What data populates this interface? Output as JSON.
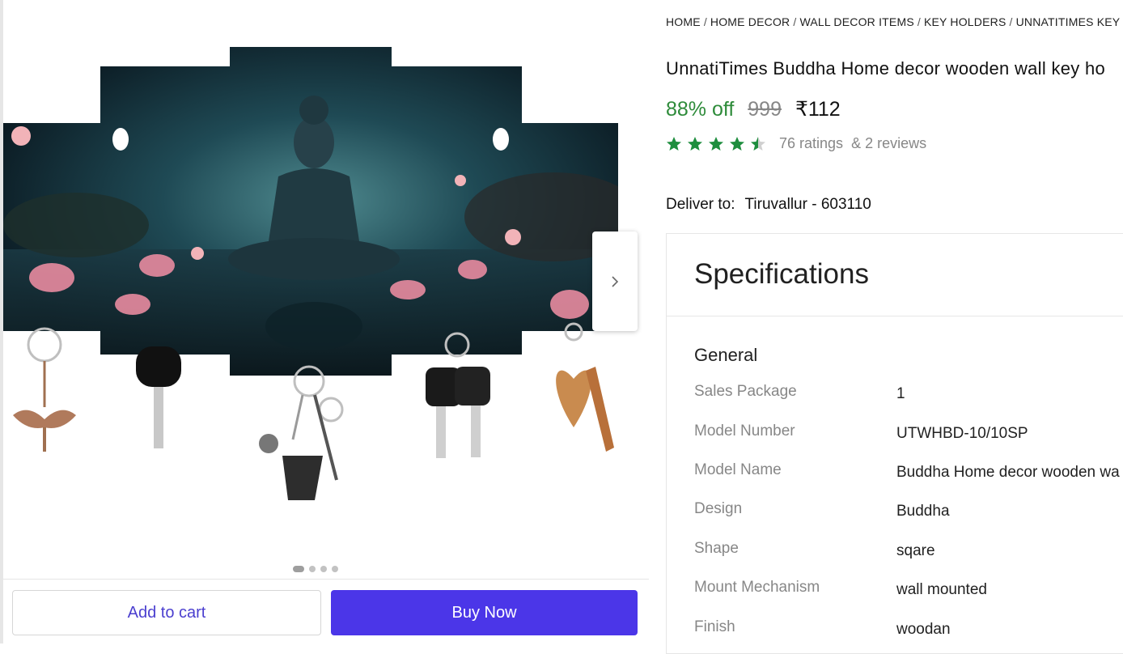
{
  "breadcrumb": [
    "HOME",
    "HOME DECOR",
    "WALL DECOR ITEMS",
    "KEY HOLDERS",
    "UNNATITIMES KEY HO"
  ],
  "product": {
    "title": "UnnatiTimes Buddha Home decor wooden wall key ho",
    "discount": "88% off",
    "mrp": "999",
    "price": "₹112",
    "rating_value": 4.5,
    "ratings": "76 ratings",
    "reviews": "& 2 reviews"
  },
  "delivery": {
    "label": "Deliver to:",
    "location": "Tiruvallur - 603110"
  },
  "gallery": {
    "image_count": 4,
    "active_index": 0
  },
  "actions": {
    "add_to_cart": "Add to cart",
    "buy_now": "Buy Now"
  },
  "specifications": {
    "title": "Specifications",
    "group": "General",
    "rows": [
      {
        "key": "Sales Package",
        "value": "1"
      },
      {
        "key": "Model Number",
        "value": "UTWHBD-10/10SP"
      },
      {
        "key": "Model Name",
        "value": "Buddha Home decor wooden wa"
      },
      {
        "key": "Design",
        "value": "Buddha"
      },
      {
        "key": "Shape",
        "value": "sqare"
      },
      {
        "key": "Mount Mechanism",
        "value": "wall mounted"
      },
      {
        "key": "Finish",
        "value": "woodan"
      }
    ]
  },
  "colors": {
    "discount_green": "#2e8b3a",
    "star_green": "#1e8e3e",
    "buy_button": "#4b36e8",
    "cart_text": "#4b3fcf"
  },
  "icons": {
    "next": "chevron-right-icon",
    "star": "star-icon"
  }
}
